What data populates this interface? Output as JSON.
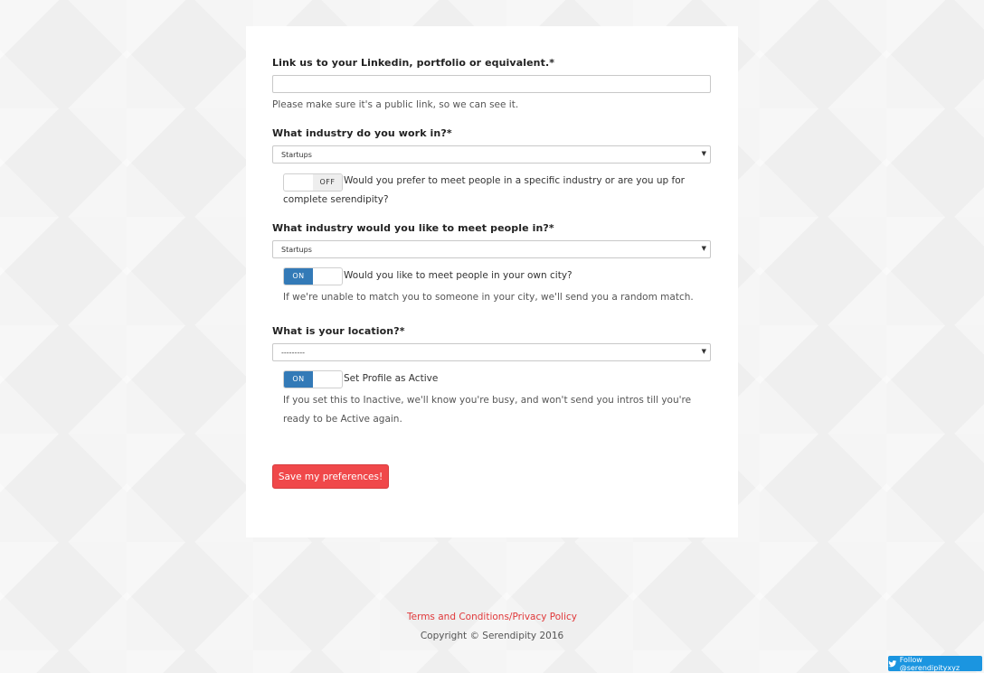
{
  "form": {
    "linkedin_label": "Link us to your Linkedin, portfolio or equivalent.*",
    "linkedin_value": "",
    "linkedin_help": "Please make sure it's a public link, so we can see it.",
    "industry_label": "What industry do you work in?*",
    "industry_selected": "Startups",
    "specific_industry_toggle": {
      "state": "OFF",
      "text": "Would you prefer to meet people in a specific industry or are you up for complete serendipity?"
    },
    "meet_industry_label": "What industry would you like to meet people in?*",
    "meet_industry_selected": "Startups",
    "own_city_toggle": {
      "state": "ON",
      "text": "Would you like to meet people in your own city?"
    },
    "own_city_help": "If we're unable to match you to someone in your city, we'll send you a random match.",
    "location_label": "What is your location?*",
    "location_selected": "---------",
    "active_toggle": {
      "state": "ON",
      "text": "Set Profile as Active"
    },
    "active_help": "If you set this to Inactive, we'll know you're busy, and won't send you intros till you're ready to be Active again.",
    "save_label": "Save my preferences!"
  },
  "footer": {
    "terms_link": "Terms and Conditions/Privacy Policy",
    "copyright": "Copyright © Serendipity 2016"
  },
  "twitter": {
    "label": "Follow @serendipityxyz",
    "icon": "twitter-bird-icon"
  },
  "colors": {
    "accent": "#f0484a",
    "toggle_on": "#337ab7",
    "twitter": "#1b95e0"
  }
}
